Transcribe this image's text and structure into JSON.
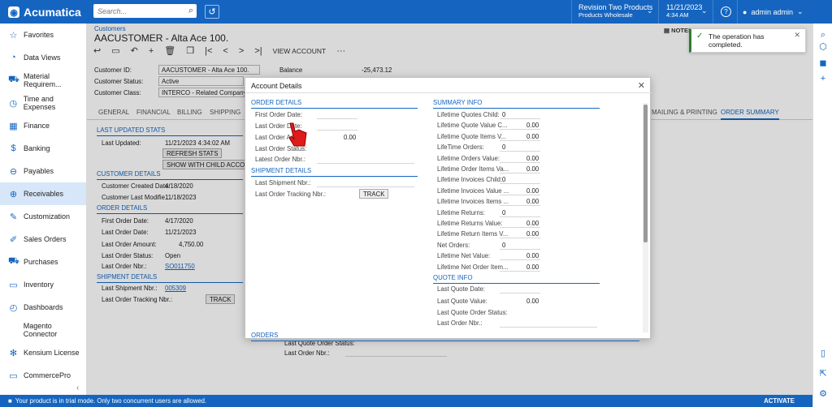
{
  "topbar": {
    "brand": "Acumatica",
    "search_placeholder": "Search...",
    "branch_line1": "Revision Two Products",
    "branch_line2": "Products Wholesale",
    "date": "11/21/2023",
    "time": "4:34 AM",
    "help": "?",
    "user": "admin admin"
  },
  "sidebar": {
    "items": [
      {
        "label": "Favorites",
        "icon": "☆"
      },
      {
        "label": "Data Views",
        "icon": "◔"
      },
      {
        "label": "Material Requirem...",
        "icon": "⛟"
      },
      {
        "label": "Time and Expenses",
        "icon": "◷"
      },
      {
        "label": "Finance",
        "icon": "▦"
      },
      {
        "label": "Banking",
        "icon": "$"
      },
      {
        "label": "Payables",
        "icon": "⊖"
      },
      {
        "label": "Receivables",
        "icon": "⊕"
      },
      {
        "label": "Customization",
        "icon": "✎"
      },
      {
        "label": "Sales Orders",
        "icon": "✐"
      },
      {
        "label": "Purchases",
        "icon": "⛟"
      },
      {
        "label": "Inventory",
        "icon": "▭"
      },
      {
        "label": "Dashboards",
        "icon": "◴"
      },
      {
        "label": "Magento Connector",
        "icon": ""
      },
      {
        "label": "Kensium License",
        "icon": "✻"
      },
      {
        "label": "CommercePro",
        "icon": "▭"
      }
    ],
    "collapse": "‹"
  },
  "page": {
    "breadcrumb": "Customers",
    "title": "AACUSTOMER - Alta Ace 100.",
    "notes": "NOTES",
    "toolbar": {
      "view_account": "VIEW ACCOUNT",
      "more": "···"
    }
  },
  "form": {
    "customer_id_label": "Customer ID:",
    "customer_id": "AACUSTOMER - Alta Ace 100.",
    "status_label": "Customer Status:",
    "status": "Active",
    "class_label": "Customer Class:",
    "class": "INTERCO - Related Company.",
    "balance_label": "Balance",
    "balance": "-25,473.12"
  },
  "tabs": {
    "general": "GENERAL",
    "financial": "FINANCIAL",
    "billing": "BILLING",
    "shipping": "SHIPPING",
    "mailing": "MAILING & PRINTING",
    "order_summary": "ORDER SUMMARY"
  },
  "summary": {
    "last_updated_stats": "LAST UPDATED STATS",
    "last_updated_label": "Last Updated:",
    "last_updated": "11/21/2023 4:34:02 AM",
    "refresh_stats": "REFRESH STATS",
    "show_child": "SHOW WITH CHILD ACCOUNTS",
    "customer_details": "CUSTOMER DETAILS",
    "created_label": "Customer Created Date:",
    "created": "4/18/2020",
    "modified_label": "Customer Last Modifie...",
    "modified": "11/18/2023",
    "order_details": "ORDER DETAILS",
    "first_order_label": "First Order Date:",
    "first_order": "4/17/2020",
    "last_order_label": "Last Order Date:",
    "last_order": "11/21/2023",
    "last_amount_label": "Last Order Amount:",
    "last_amount": "4,750.00",
    "last_status_label": "Last Order Status:",
    "last_status": "Open",
    "last_nbr_label": "Last Order Nbr.:",
    "last_nbr": "SO011750",
    "shipment_details": "SHIPMENT DETAILS",
    "last_ship_label": "Last Shipment Nbr.:",
    "last_ship": "005309",
    "tracking_label": "Last Order Tracking Nbr.:",
    "track": "TRACK",
    "behind_last_quote_status": "Last Quote Order Status:",
    "behind_last_order_nbr": "Last Order Nbr.:"
  },
  "modal": {
    "title": "Account Details",
    "close": "✕",
    "order_details": "ORDER DETAILS",
    "first_order_date": "First Order Date:",
    "last_order_date": "Last Order Date:",
    "last_order_amount": "Last Order Amo...",
    "last_order_amount_value": "0.00",
    "last_order_status": "Last Order Status:",
    "latest_order_nbr": "Latest Order Nbr.:",
    "shipment_details": "SHIPMENT DETAILS",
    "last_shipment_nbr": "Last Shipment Nbr.:",
    "last_tracking_nbr": "Last Order Tracking Nbr.:",
    "track": "TRACK",
    "summary_info": "SUMMARY INFO",
    "summary_rows": [
      {
        "label": "Lifetime Quotes Child:",
        "value": "0",
        "int": true
      },
      {
        "label": "Lifetime Quote Value C...",
        "value": "0.00",
        "int": false
      },
      {
        "label": "Lifetime Quote Items V...",
        "value": "0.00",
        "int": false
      },
      {
        "label": "LifeTime Orders:",
        "value": "0",
        "int": true
      },
      {
        "label": "Lifetime Orders Value:",
        "value": "0.00",
        "int": false
      },
      {
        "label": "Lifetime Order Items Va...",
        "value": "0.00",
        "int": false
      },
      {
        "label": "Lifetime Invoices Child:",
        "value": "0",
        "int": true
      },
      {
        "label": "Lifetime Invoices Value ...",
        "value": "0.00",
        "int": false
      },
      {
        "label": "Lifetime Invoices Items ...",
        "value": "0.00",
        "int": false
      },
      {
        "label": "Lifetime Returns:",
        "value": "0",
        "int": true
      },
      {
        "label": "Lifetime Returns Value:",
        "value": "0.00",
        "int": false
      },
      {
        "label": "Lifetime Return Items V...",
        "value": "0.00",
        "int": false
      },
      {
        "label": "Net Orders:",
        "value": "0",
        "int": true
      },
      {
        "label": "Lifetime Net Value:",
        "value": "0.00",
        "int": false
      },
      {
        "label": "Lifetime Net Order Item...",
        "value": "0.00",
        "int": false
      }
    ],
    "quote_info": "QUOTE INFO",
    "last_quote_date": "Last Quote Date:",
    "last_quote_value": "Last Quote Value:",
    "last_quote_value_value": "0.00",
    "last_quote_order_status": "Last Quote Order Status:",
    "last_order_nbr": "Last Order Nbr.:",
    "orders": "ORDERS"
  },
  "toast": {
    "message": "The operation has completed.",
    "close": "✕"
  },
  "bottombar": {
    "trial": "Your product is in trial mode. Only two concurrent users are allowed.",
    "activate": "ACTIVATE"
  },
  "colors": {
    "brand": "#1565c0",
    "success": "#2e7d32",
    "cursor": "#e01b1b"
  }
}
